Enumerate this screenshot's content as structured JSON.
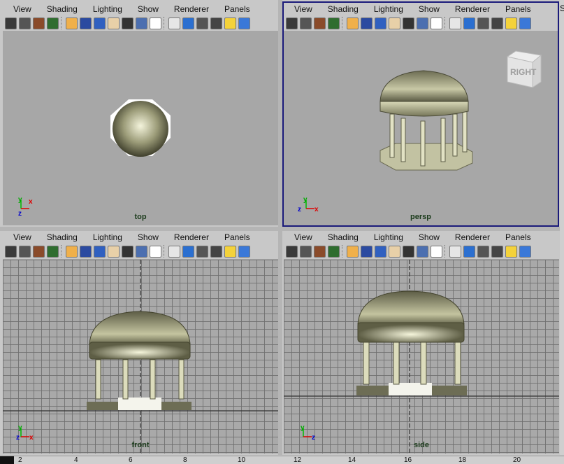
{
  "menus": [
    "View",
    "Shading",
    "Lighting",
    "Show",
    "Renderer",
    "Panels"
  ],
  "panels": [
    {
      "label": "top"
    },
    {
      "label": "persp"
    },
    {
      "label": "front"
    },
    {
      "label": "side"
    }
  ],
  "viewcube": {
    "label": "RIGHT"
  },
  "axes": {
    "x": "x",
    "y": "y",
    "z": "z"
  },
  "ruler_ticks": [
    "2",
    "4",
    "6",
    "8",
    "10",
    "12",
    "14",
    "16",
    "18",
    "20"
  ],
  "right_edge_letter": "S"
}
